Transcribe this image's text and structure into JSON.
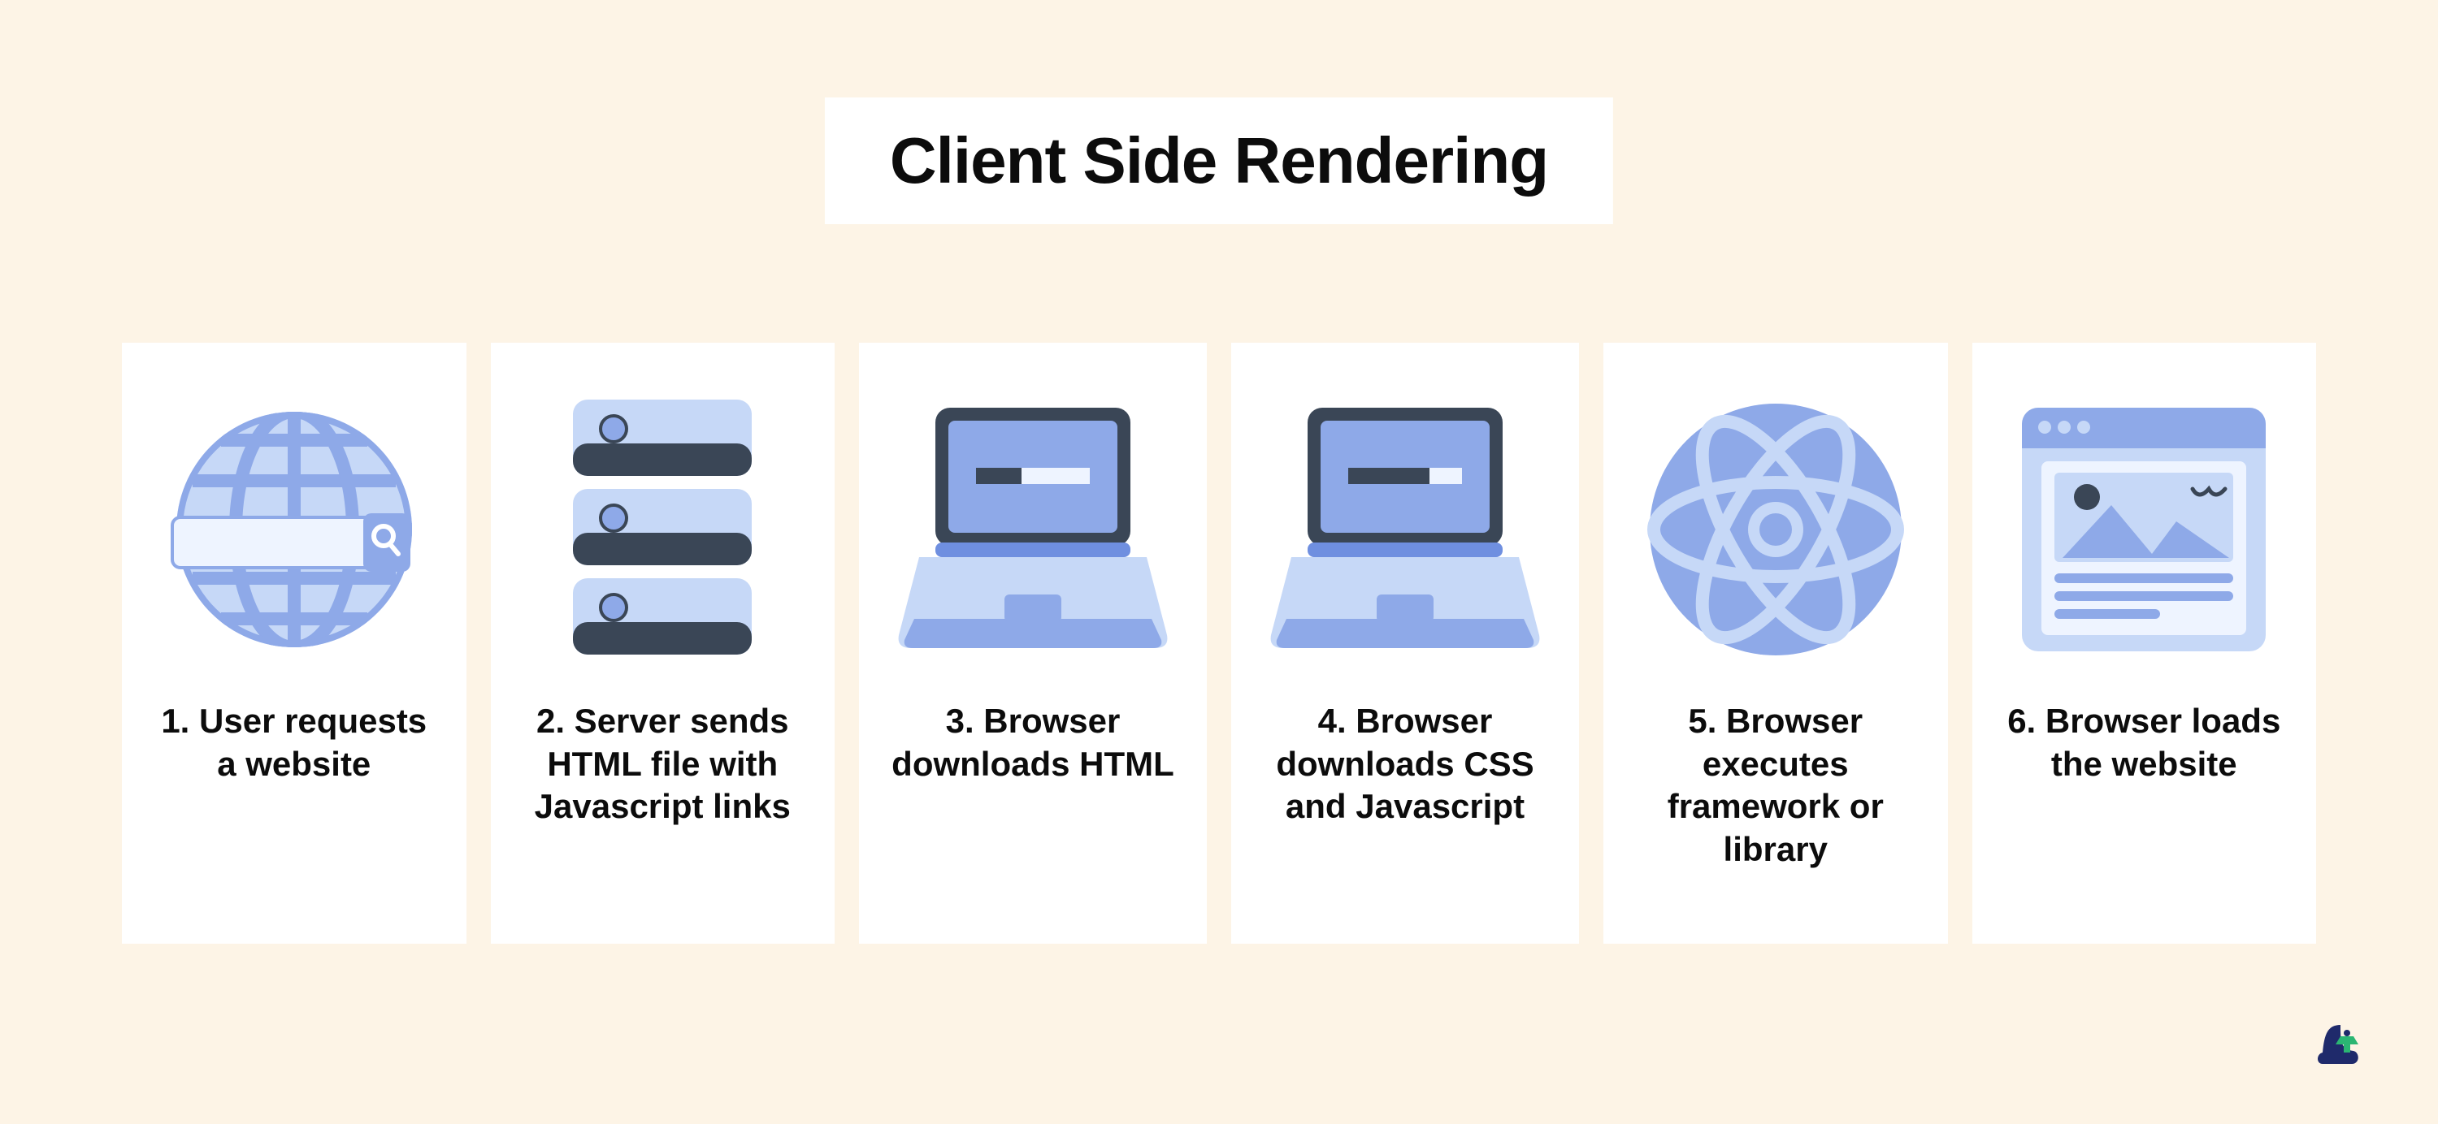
{
  "title": "Client Side Rendering",
  "steps": [
    {
      "icon": "globe-search-icon",
      "label": "1. User requests a website"
    },
    {
      "icon": "server-stack-icon",
      "label": "2. Server sends HTML file with Javascript links"
    },
    {
      "icon": "laptop-loading-icon",
      "label": "3. Browser downloads HTML"
    },
    {
      "icon": "laptop-loading-more-icon",
      "label": "4. Browser downloads CSS and Javascript"
    },
    {
      "icon": "react-atom-icon",
      "label": "5. Browser executes framework or library"
    },
    {
      "icon": "browser-page-icon",
      "label": "6. Browser loads the website"
    }
  ],
  "colors": {
    "bg": "#fdf4e6",
    "card": "#ffffff",
    "text": "#0c0c0c",
    "blue_light": "#c6d8f7",
    "blue_mid": "#8ea9e8",
    "blue_dark": "#6f8fe0",
    "slate": "#3a4656",
    "navy": "#1f2a6b",
    "green": "#2bb673"
  }
}
